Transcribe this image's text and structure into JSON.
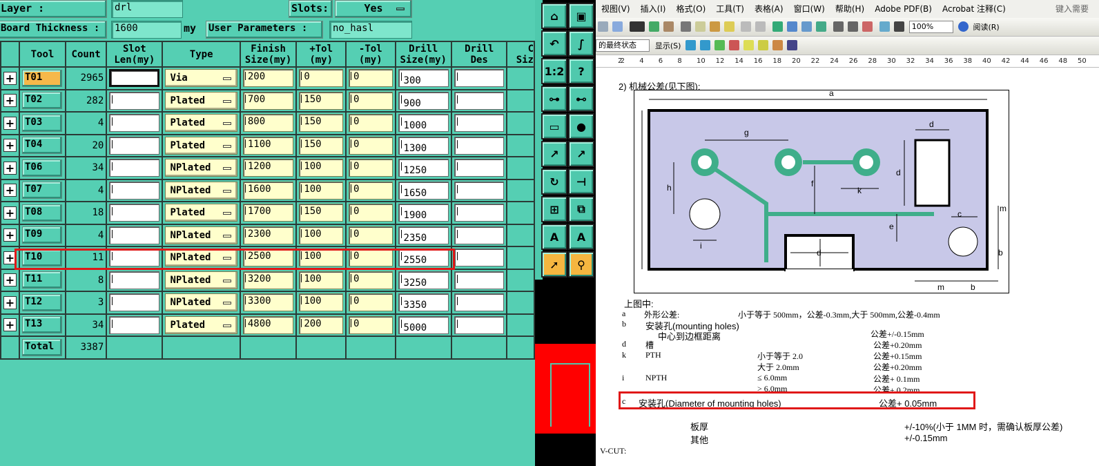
{
  "panel": {
    "layer_label": "Layer :",
    "layer_value": "drl",
    "slots_label": "Slots:",
    "slots_value": "Yes",
    "board_thickness_label": "Board Thickness :",
    "board_thickness_value": "1600",
    "board_thickness_unit": "my",
    "user_params_label": "User Parameters :",
    "user_params_value": "no_hasl"
  },
  "columns": [
    {
      "key": "expander",
      "label": ""
    },
    {
      "key": "tool",
      "label": "Tool"
    },
    {
      "key": "count",
      "label": "Count"
    },
    {
      "key": "slot_len",
      "label": "Slot\nLen(my)"
    },
    {
      "key": "type",
      "label": "Type"
    },
    {
      "key": "finish",
      "label": "Finish\nSize(my)"
    },
    {
      "key": "ptol",
      "label": "+Tol\n(my)"
    },
    {
      "key": "mtol",
      "label": "-Tol\n(my)"
    },
    {
      "key": "drill",
      "label": "Drill\nSize(my)"
    },
    {
      "key": "drill_des",
      "label": "Drill\nDes"
    },
    {
      "key": "more",
      "label": "C\nSiz"
    }
  ],
  "rows": [
    {
      "tool": "T01",
      "count": "2965",
      "type": "Via",
      "finish": "200",
      "ptol": "0",
      "mtol": "0",
      "drill": "300",
      "selected": true
    },
    {
      "tool": "T02",
      "count": "282",
      "type": "Plated",
      "finish": "700",
      "ptol": "150",
      "mtol": "0",
      "drill": "900"
    },
    {
      "tool": "T03",
      "count": "4",
      "type": "Plated",
      "finish": "800",
      "ptol": "150",
      "mtol": "0",
      "drill": "1000"
    },
    {
      "tool": "T04",
      "count": "20",
      "type": "Plated",
      "finish": "1100",
      "ptol": "150",
      "mtol": "0",
      "drill": "1300"
    },
    {
      "tool": "T06",
      "count": "34",
      "type": "NPlated",
      "finish": "1200",
      "ptol": "100",
      "mtol": "0",
      "drill": "1250"
    },
    {
      "tool": "T07",
      "count": "4",
      "type": "NPlated",
      "finish": "1600",
      "ptol": "100",
      "mtol": "0",
      "drill": "1650"
    },
    {
      "tool": "T08",
      "count": "18",
      "type": "Plated",
      "finish": "1700",
      "ptol": "150",
      "mtol": "0",
      "drill": "1900"
    },
    {
      "tool": "T09",
      "count": "4",
      "type": "NPlated",
      "finish": "2300",
      "ptol": "100",
      "mtol": "0",
      "drill": "2350"
    },
    {
      "tool": "T10",
      "count": "11",
      "type": "NPlated",
      "finish": "2500",
      "ptol": "100",
      "mtol": "0",
      "drill": "2550",
      "highlighted": true
    },
    {
      "tool": "T11",
      "count": "8",
      "type": "NPlated",
      "finish": "3200",
      "ptol": "100",
      "mtol": "0",
      "drill": "3250"
    },
    {
      "tool": "T12",
      "count": "3",
      "type": "NPlated",
      "finish": "3300",
      "ptol": "100",
      "mtol": "0",
      "drill": "3350"
    },
    {
      "tool": "T13",
      "count": "34",
      "type": "Plated",
      "finish": "4800",
      "ptol": "200",
      "mtol": "0",
      "drill": "5000"
    }
  ],
  "total": {
    "label": "Total",
    "count": "3387"
  },
  "toolbox": {
    "icons": [
      "home-icon",
      "zoom-box-icon",
      "back-icon",
      "curve-icon",
      "scale-icon",
      "help-icon",
      "net-connect-icon",
      "net-highlight-icon",
      "ruler-icon",
      "pad-icon",
      "point-to-point-icon",
      "measure-icon",
      "undo-icon",
      "flip-icon",
      "snap-icon",
      "layer-copy-icon",
      "dimension-icon",
      "arrow-dimension-icon",
      "pointer-icon",
      "select-net-icon"
    ]
  },
  "word": {
    "menus": [
      "视图(V)",
      "插入(I)",
      "格式(O)",
      "工具(T)",
      "表格(A)",
      "窗口(W)",
      "帮助(H)",
      "Adobe PDF(B)",
      "Acrobat 注释(C)"
    ],
    "help_placeholder": "键入需要",
    "zoom": "100%",
    "read_mode": "阅读(R)",
    "final_state": "的最终状态",
    "show_label": "显示(S)",
    "ruler_ticks": [
      "2",
      "2",
      "4",
      "6",
      "8",
      "10",
      "12",
      "14",
      "16",
      "18",
      "20",
      "22",
      "24",
      "26",
      "28",
      "30",
      "32",
      "34",
      "36",
      "38",
      "40",
      "42",
      "44",
      "46",
      "48",
      "50"
    ],
    "heading": "2) 机械公差(见下图):",
    "diagram_labels": [
      "a",
      "d",
      "g",
      "d",
      "h",
      "f",
      "k",
      "c",
      "m",
      "e",
      "i",
      "d",
      "b",
      "m",
      "b"
    ],
    "caption": "上图中:",
    "tolerances": [
      {
        "code": "a",
        "name": "外形公差:",
        "desc": "小于等于 500mm，公差-0.3mm,大于 500mm,公差-0.4mm"
      },
      {
        "code": "b",
        "name": "安装孔(mounting holes)",
        "sub": "中心到边框距离",
        "desc": "公差+/-0.15mm"
      },
      {
        "code": "d",
        "name": "槽",
        "desc": "公差+0.20mm"
      },
      {
        "code": "k",
        "name": "PTH",
        "cond": "小于等于 2.0",
        "desc": "公差+0.15mm"
      },
      {
        "code": "",
        "name": "",
        "cond": "大于 2.0mm",
        "desc": "公差+0.20mm"
      },
      {
        "code": "i",
        "name": "NPTH",
        "cond": "≤ 6.0mm",
        "desc": "公差+ 0.1mm"
      },
      {
        "code": "",
        "name": "",
        "cond": "> 6.0mm",
        "desc": "公差+ 0.2mm"
      },
      {
        "code": "c",
        "name": "安装孔(Diameter of mounting holes)",
        "desc": "公差+ 0.05mm"
      }
    ],
    "board_thickness": {
      "name": "板厚",
      "desc": "+/-10%(小于 1MM 时，需确认板厚公差)"
    },
    "other": {
      "name": "其他",
      "desc": "+/-0.15mm"
    },
    "vcut": "V-CUT:"
  },
  "colors": {
    "panel_bg": "#55cfb3",
    "highlight": "#e01818",
    "selected_tool": "#f6b84a",
    "board_fill": "#c8c8e8",
    "trace": "#3fae8a"
  }
}
